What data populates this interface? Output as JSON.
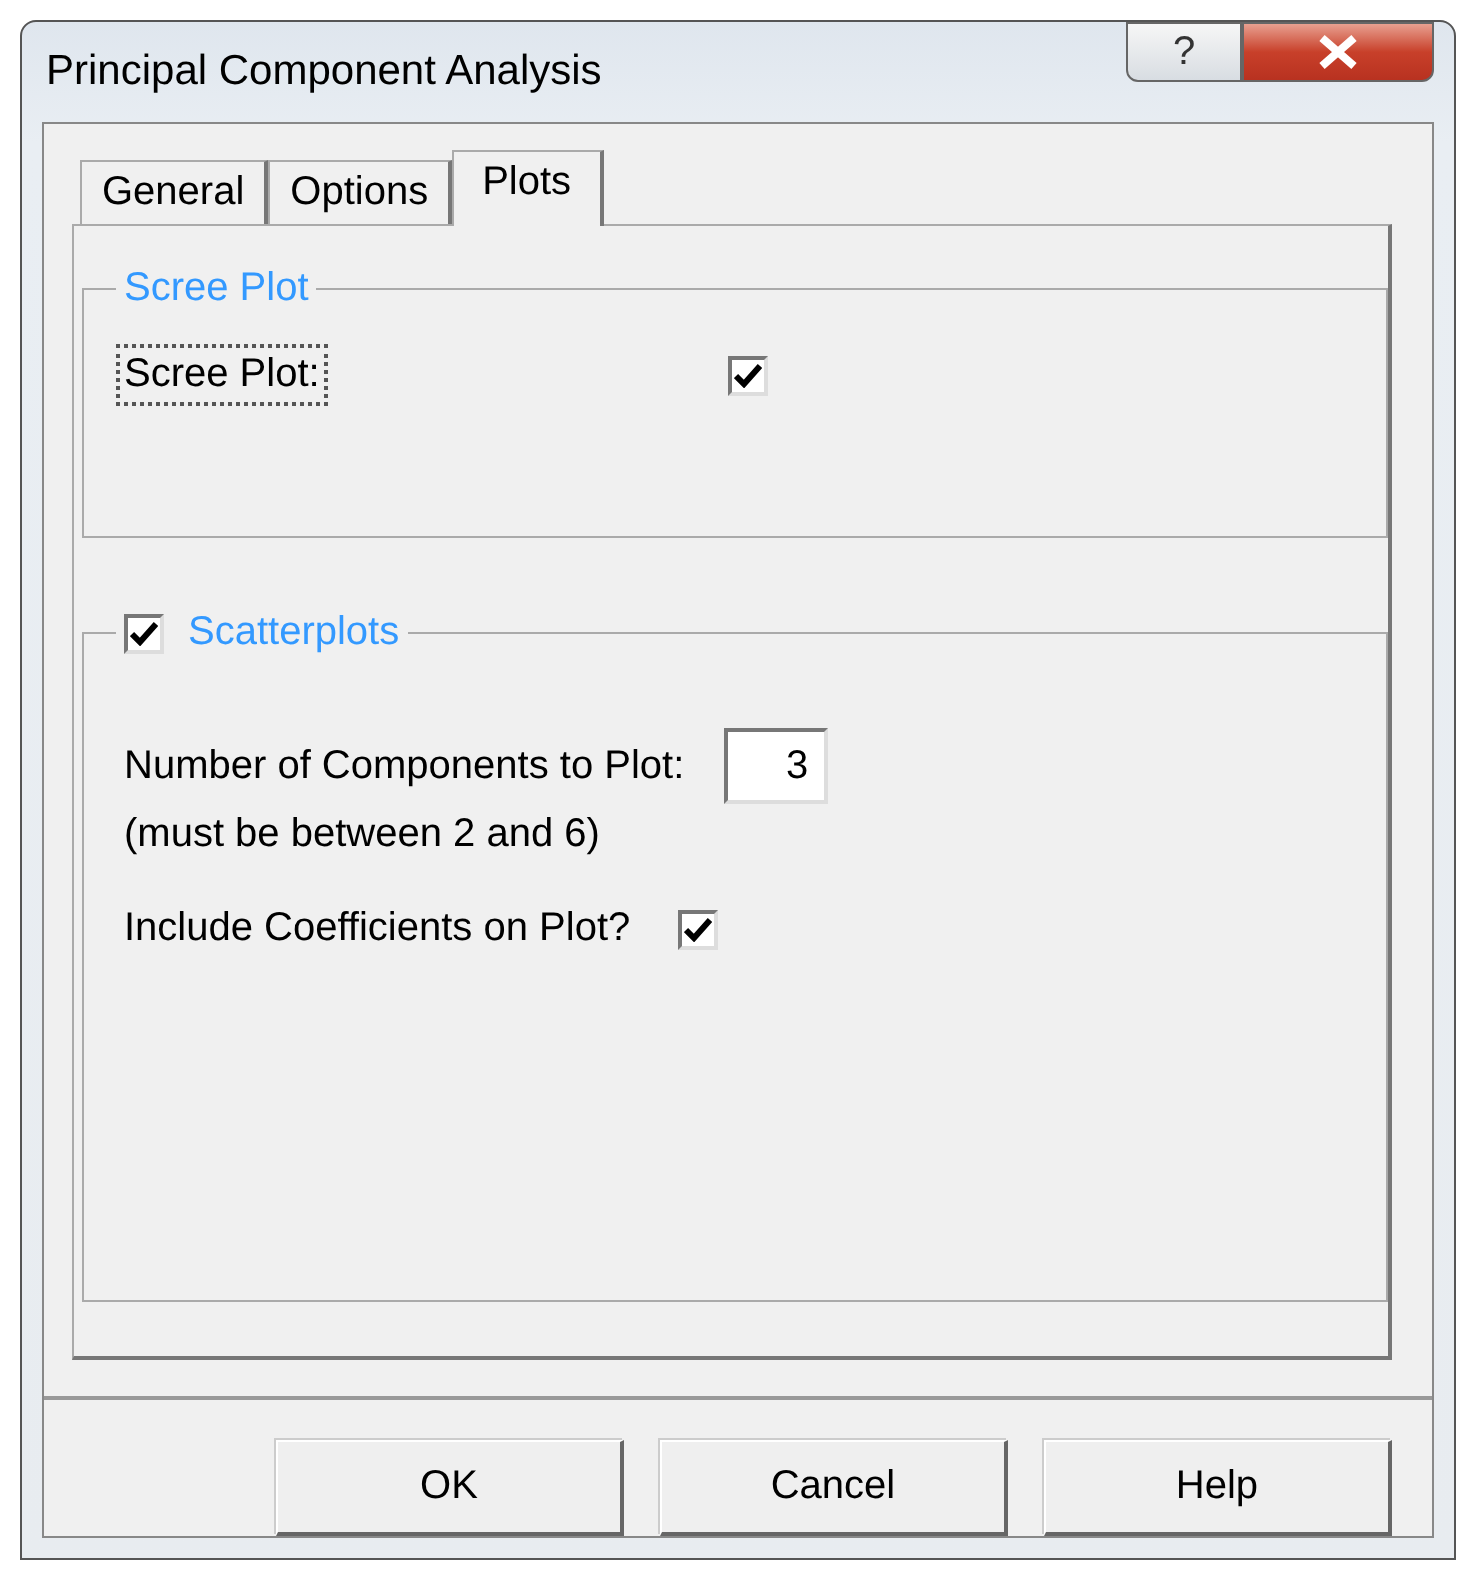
{
  "window": {
    "title": "Principal Component Analysis",
    "help_glyph": "?"
  },
  "tabs": [
    {
      "label": "General",
      "selected": false
    },
    {
      "label": "Options",
      "selected": false
    },
    {
      "label": "Plots",
      "selected": true
    }
  ],
  "scree_group": {
    "title": "Scree Plot",
    "option": {
      "label": "Scree Plot:",
      "checked": true,
      "focused": true
    }
  },
  "scatter_group": {
    "title": "Scatterplots",
    "checked": true,
    "components": {
      "label": "Number of Components to Plot:",
      "value": "3",
      "hint": "(must be between 2 and 6)"
    },
    "coefficients": {
      "label": "Include Coefficients on Plot?",
      "checked": true
    }
  },
  "buttons": [
    "OK",
    "Cancel",
    "Help"
  ]
}
